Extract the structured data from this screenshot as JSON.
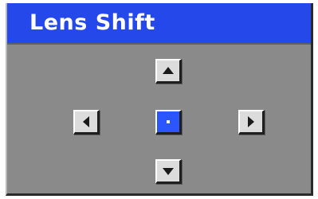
{
  "window": {
    "title": "Lens Shift"
  },
  "controls": {
    "up": {
      "icon": "triangle-up-icon"
    },
    "left": {
      "icon": "triangle-left-icon"
    },
    "center": {
      "icon": "dot-icon",
      "selected": true
    },
    "right": {
      "icon": "triangle-right-icon"
    },
    "down": {
      "icon": "triangle-down-icon"
    }
  },
  "colors": {
    "title_bar": "#2448ea",
    "panel_background": "#8a8a8a",
    "button_face": "#dcdcdc",
    "selected_button": "#2a55ff",
    "title_text": "#ffffff"
  }
}
